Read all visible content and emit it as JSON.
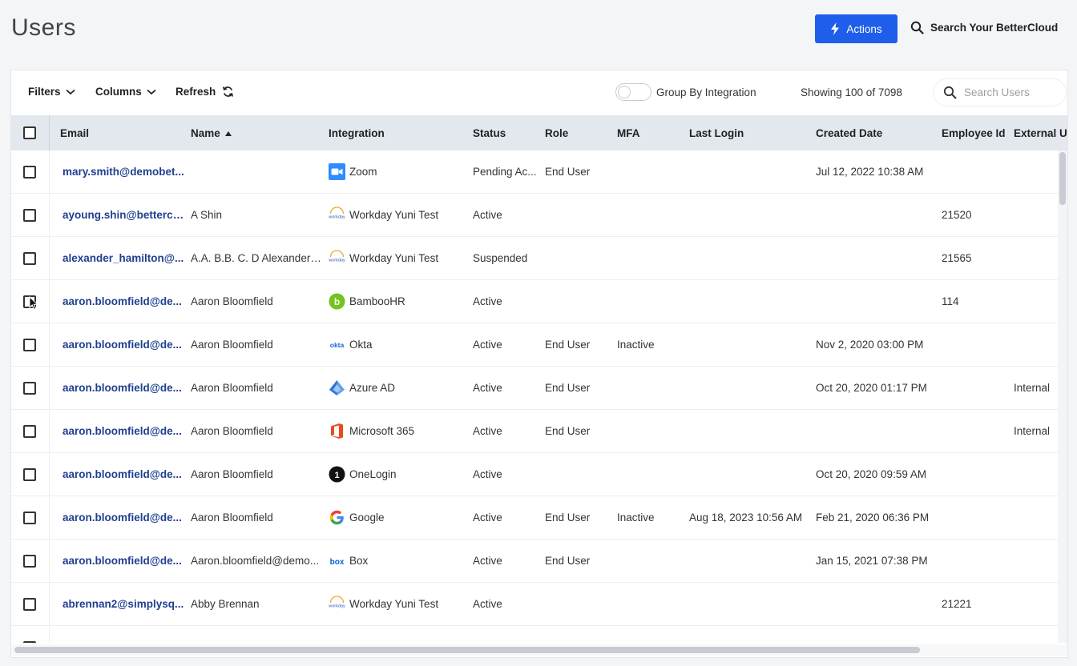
{
  "header": {
    "title": "Users",
    "actions_label": "Actions",
    "global_search_label": "Search Your BetterCloud"
  },
  "toolbar": {
    "filters_label": "Filters",
    "columns_label": "Columns",
    "refresh_label": "Refresh",
    "group_by_label": "Group By Integration",
    "group_by_enabled": false,
    "showing_text": "Showing 100 of 7098",
    "search_placeholder": "Search Users"
  },
  "table": {
    "columns": {
      "email": "Email",
      "name": "Name",
      "integration": "Integration",
      "status": "Status",
      "role": "Role",
      "mfa": "MFA",
      "last_login": "Last Login",
      "created_date": "Created Date",
      "employee_id": "Employee Id",
      "external": "External Us"
    },
    "sort": {
      "column": "name",
      "direction": "ascending"
    },
    "rows": [
      {
        "email": "mary.smith@demobet...",
        "name": "",
        "integration": "Zoom",
        "icon": "zoom-icon",
        "status": "Pending Ac...",
        "role": "End User",
        "mfa": "",
        "last_login": "",
        "created_date": "Jul 12, 2022 10:38 AM",
        "employee_id": "",
        "external": ""
      },
      {
        "email": "ayoung.shin@bettercl...",
        "name": "A Shin",
        "integration": "Workday Yuni Test",
        "icon": "workday-icon",
        "status": "Active",
        "role": "",
        "mfa": "",
        "last_login": "",
        "created_date": "",
        "employee_id": "21520",
        "external": ""
      },
      {
        "email": "alexander_hamilton@...",
        "name": "A.A. B.B. C. D Alexander ...",
        "integration": "Workday Yuni Test",
        "icon": "workday-icon",
        "status": "Suspended",
        "role": "",
        "mfa": "",
        "last_login": "",
        "created_date": "",
        "employee_id": "21565",
        "external": ""
      },
      {
        "email": "aaron.bloomfield@de...",
        "name": "Aaron Bloomfield",
        "integration": "BambooHR",
        "icon": "bamboohr-icon",
        "status": "Active",
        "role": "",
        "mfa": "",
        "last_login": "",
        "created_date": "",
        "employee_id": "114",
        "external": ""
      },
      {
        "email": "aaron.bloomfield@de...",
        "name": "Aaron Bloomfield",
        "integration": "Okta",
        "icon": "okta-icon",
        "status": "Active",
        "role": "End User",
        "mfa": "Inactive",
        "last_login": "",
        "created_date": "Nov 2, 2020 03:00 PM",
        "employee_id": "",
        "external": ""
      },
      {
        "email": "aaron.bloomfield@de...",
        "name": "Aaron Bloomfield",
        "integration": "Azure AD",
        "icon": "azure-ad-icon",
        "status": "Active",
        "role": "End User",
        "mfa": "",
        "last_login": "",
        "created_date": "Oct 20, 2020 01:17 PM",
        "employee_id": "",
        "external": "Internal"
      },
      {
        "email": "aaron.bloomfield@de...",
        "name": "Aaron Bloomfield",
        "integration": "Microsoft 365",
        "icon": "microsoft-365-icon",
        "status": "Active",
        "role": "End User",
        "mfa": "",
        "last_login": "",
        "created_date": "",
        "employee_id": "",
        "external": "Internal"
      },
      {
        "email": "aaron.bloomfield@de...",
        "name": "Aaron Bloomfield",
        "integration": "OneLogin",
        "icon": "onelogin-icon",
        "status": "Active",
        "role": "",
        "mfa": "",
        "last_login": "",
        "created_date": "Oct 20, 2020 09:59 AM",
        "employee_id": "",
        "external": ""
      },
      {
        "email": "aaron.bloomfield@de...",
        "name": "Aaron Bloomfield",
        "integration": "Google",
        "icon": "google-icon",
        "status": "Active",
        "role": "End User",
        "mfa": "Inactive",
        "last_login": "Aug 18, 2023 10:56 AM",
        "created_date": "Feb 21, 2020 06:36 PM",
        "employee_id": "",
        "external": ""
      },
      {
        "email": "aaron.bloomfield@de...",
        "name": "Aaron.bloomfield@demo...",
        "integration": "Box",
        "icon": "box-icon",
        "status": "Active",
        "role": "End User",
        "mfa": "",
        "last_login": "",
        "created_date": "Jan 15, 2021 07:38 PM",
        "employee_id": "",
        "external": ""
      },
      {
        "email": "abrennan2@simplysq...",
        "name": "Abby Brennan",
        "integration": "Workday Yuni Test",
        "icon": "workday-icon",
        "status": "Active",
        "role": "",
        "mfa": "",
        "last_login": "",
        "created_date": "",
        "employee_id": "21221",
        "external": ""
      }
    ]
  }
}
